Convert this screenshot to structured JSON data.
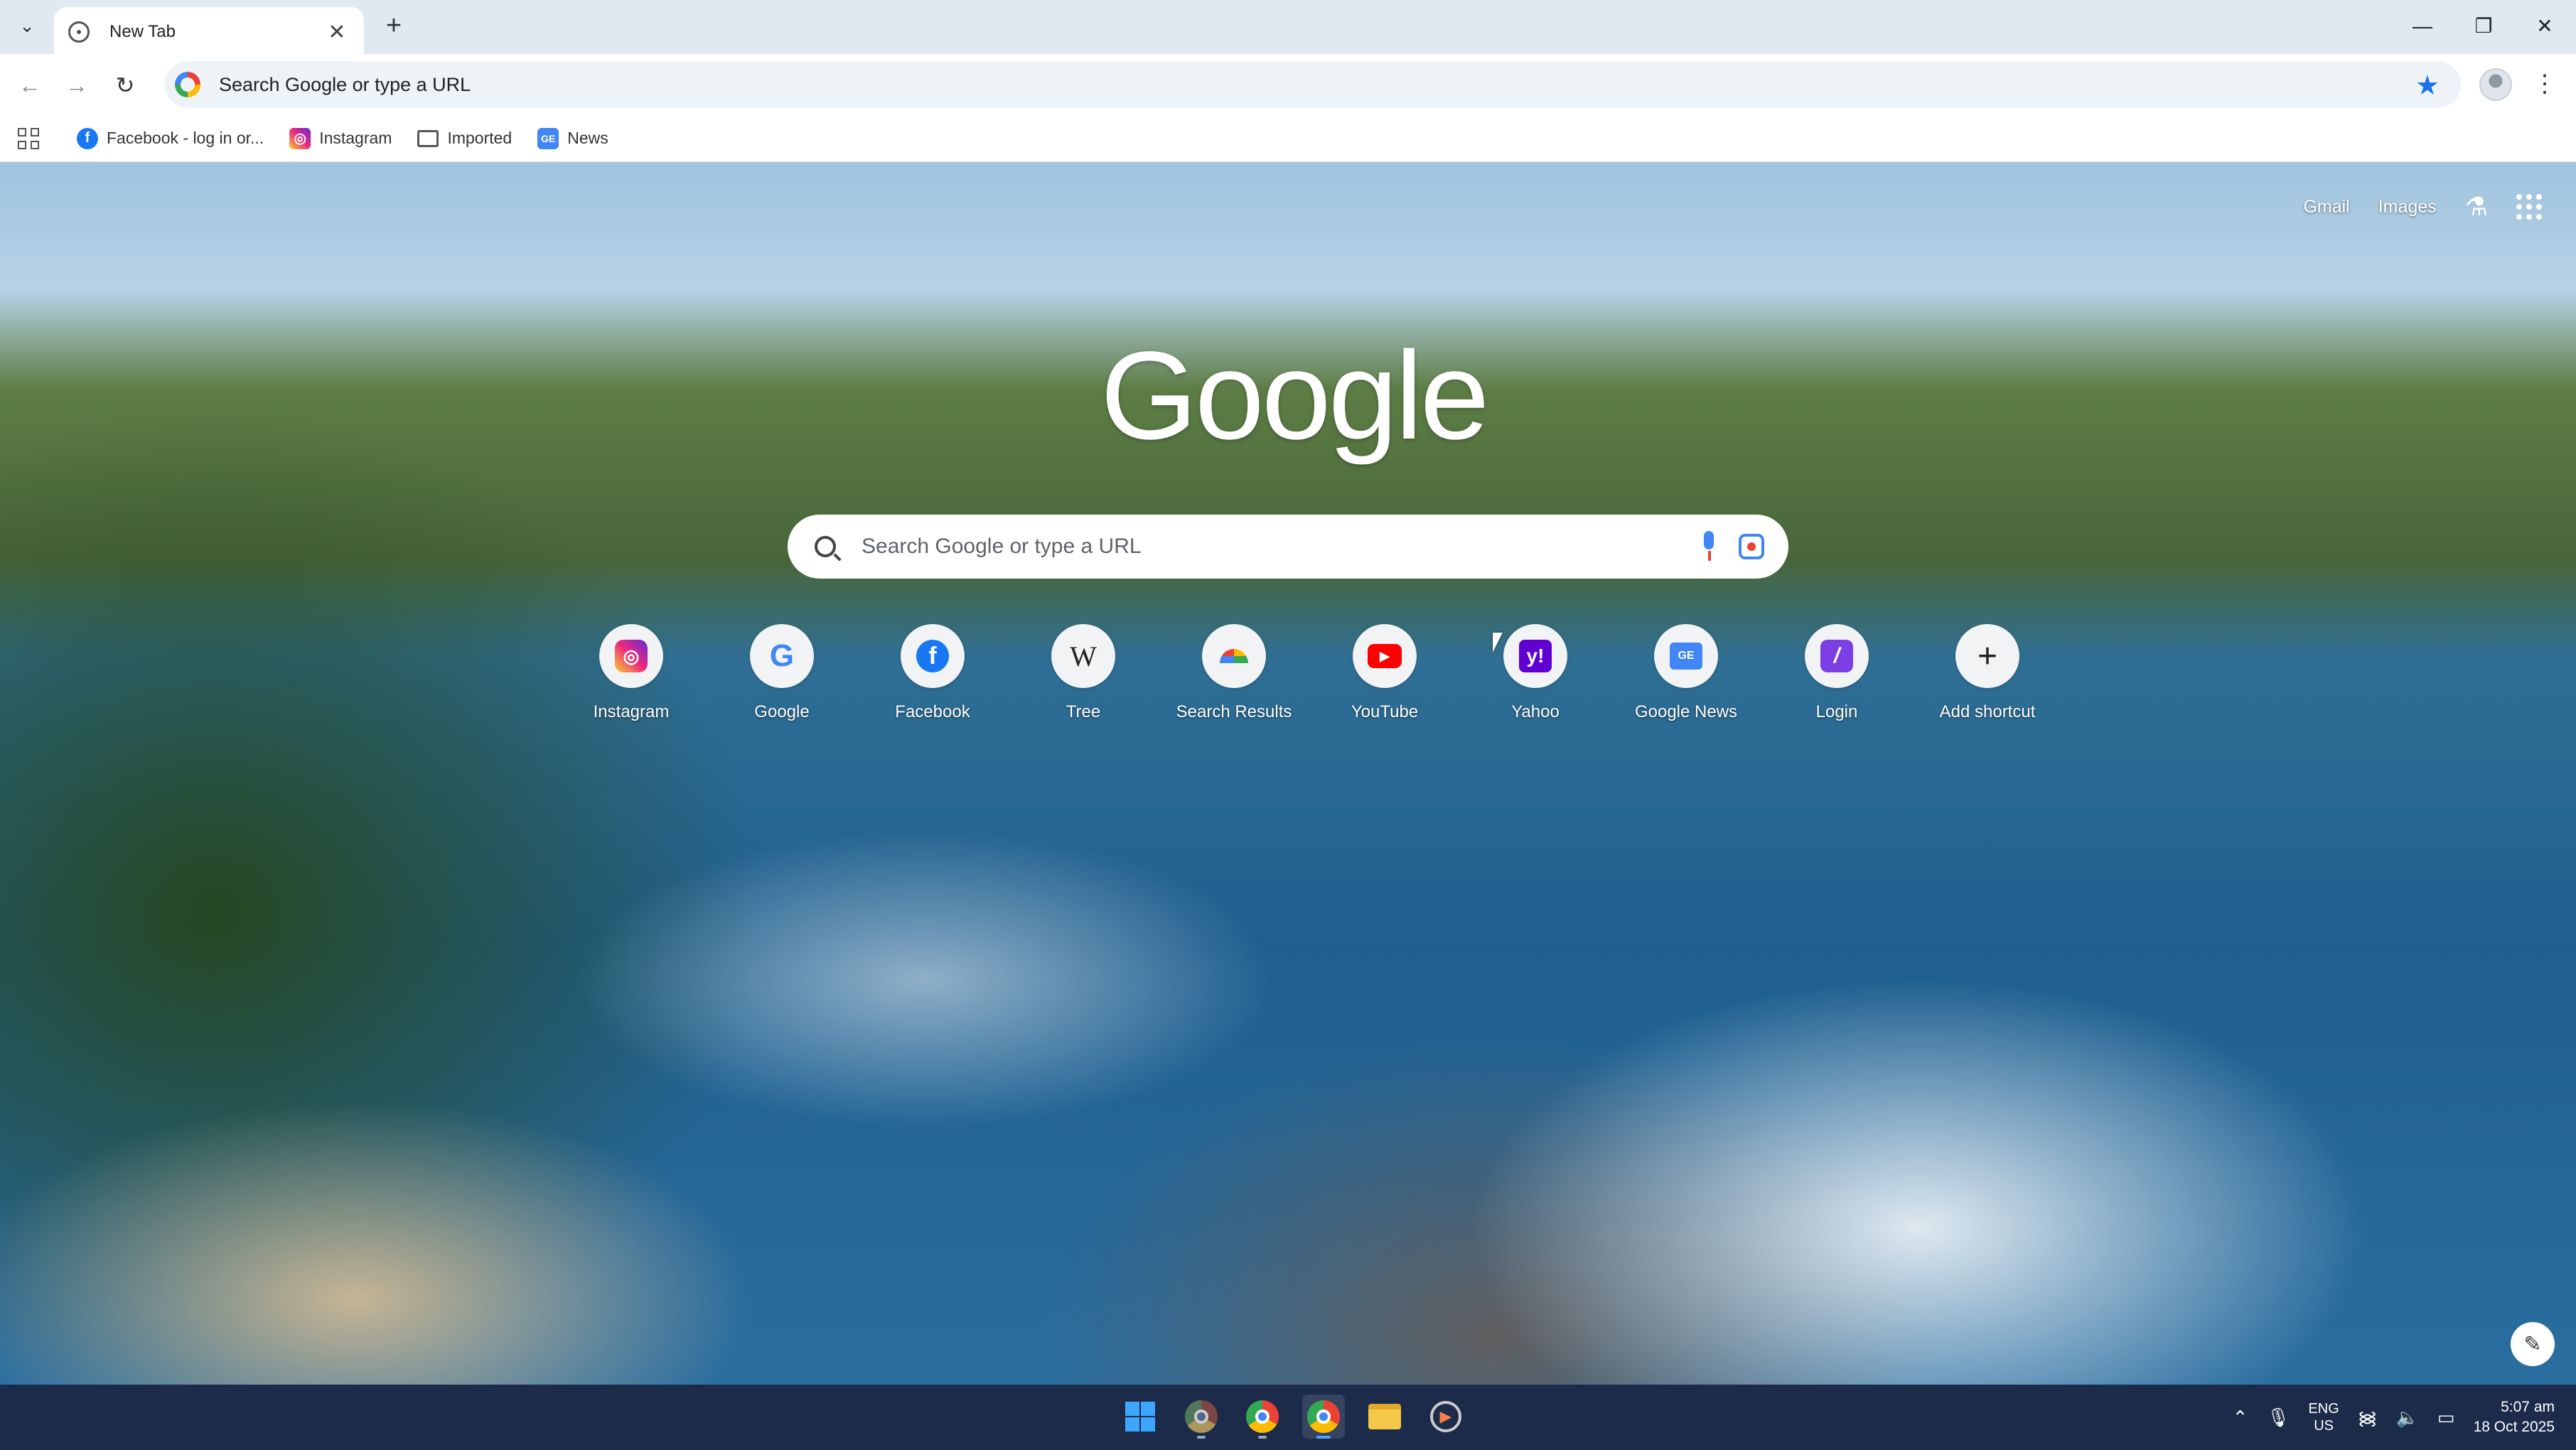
{
  "browser": {
    "tab": {
      "title": "New Tab",
      "close_glyph": "✕"
    },
    "new_tab_glyph": "+",
    "window_controls": {
      "minimize": "—",
      "restore": "❐",
      "close": "✕"
    },
    "omnibox": {
      "text": "Search Google or type a URL"
    },
    "bookmarks": [
      {
        "label": "Facebook - log in or...",
        "icon": "facebook-icon"
      },
      {
        "label": "Instagram",
        "icon": "instagram-icon"
      },
      {
        "label": "Imported",
        "icon": "folder-icon"
      },
      {
        "label": "News",
        "icon": "news-icon"
      }
    ]
  },
  "ntp": {
    "top_links": {
      "gmail": "Gmail",
      "images": "Images"
    },
    "logo": "Google",
    "search_placeholder": "Search Google or type a URL",
    "shortcuts": [
      {
        "label": "Instagram",
        "icon": "instagram-icon",
        "glyph": "◎"
      },
      {
        "label": "Google",
        "icon": "google-icon",
        "glyph": "G"
      },
      {
        "label": "Facebook",
        "icon": "facebook-icon",
        "glyph": "f"
      },
      {
        "label": "Tree",
        "icon": "wikipedia-icon",
        "glyph": "W"
      },
      {
        "label": "Search Results",
        "icon": "search-results-icon",
        "glyph": ""
      },
      {
        "label": "YouTube",
        "icon": "youtube-icon",
        "glyph": "▶"
      },
      {
        "label": "Yahoo",
        "icon": "yahoo-icon",
        "glyph": "y!"
      },
      {
        "label": "Google News",
        "icon": "google-news-icon",
        "glyph": "GE"
      },
      {
        "label": "Login",
        "icon": "login-icon",
        "glyph": "/"
      },
      {
        "label": "Add shortcut",
        "icon": "plus-icon",
        "glyph": "+"
      }
    ]
  },
  "taskbar": {
    "language": {
      "line1": "ENG",
      "line2": "US"
    },
    "clock": {
      "time": "5:07 am",
      "date": "18 Oct 2025"
    }
  },
  "colors": {
    "accent": "#1a73e8",
    "taskbar": "#1c2b4a"
  }
}
